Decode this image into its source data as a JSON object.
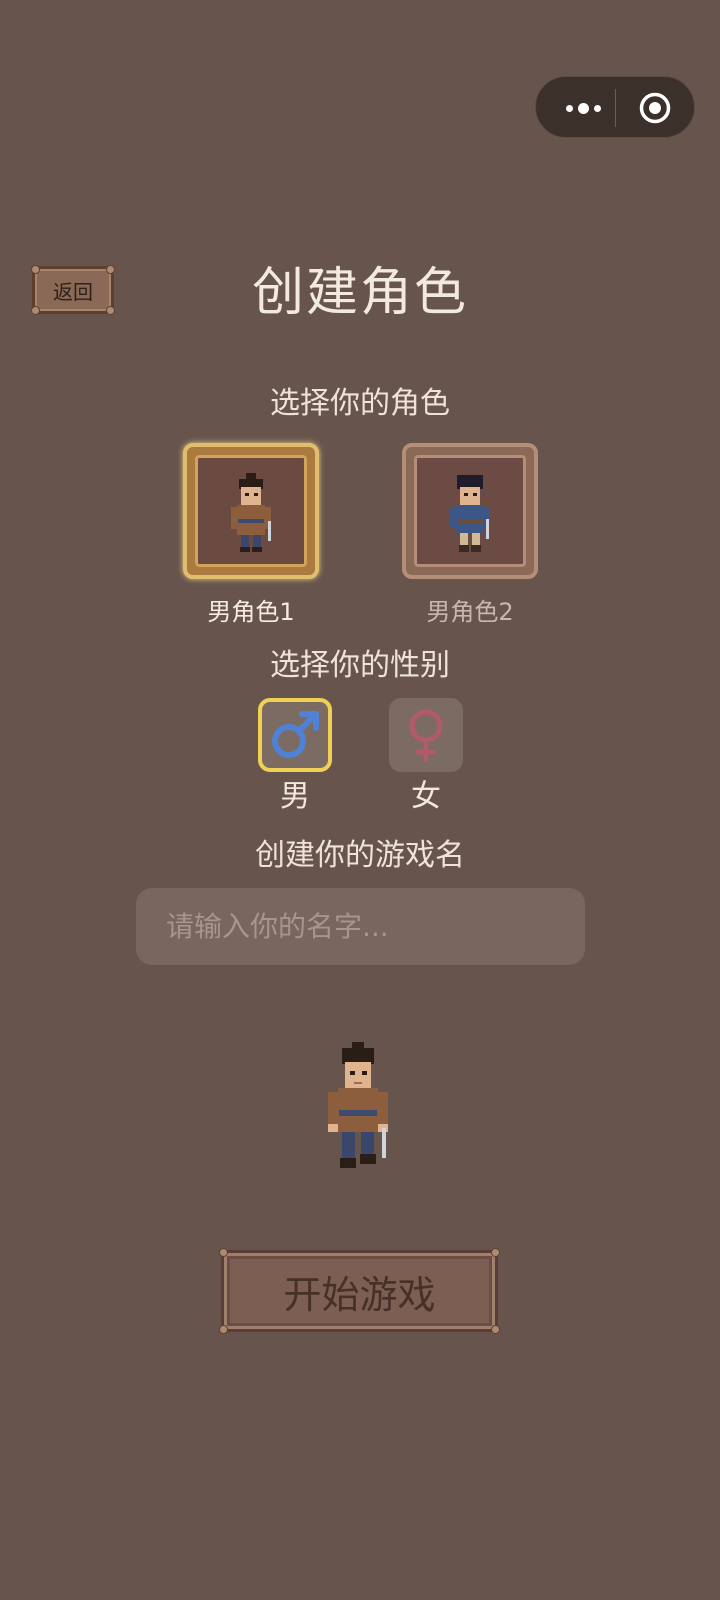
{
  "header": {
    "back_label": "返回",
    "title": "创建角色"
  },
  "capsule": {
    "more_icon": "more-dots-icon",
    "close_icon": "target-circle-icon"
  },
  "character": {
    "section_label": "选择你的角色",
    "options": [
      {
        "label": "男角色1",
        "selected": true
      },
      {
        "label": "男角色2",
        "selected": false
      }
    ]
  },
  "gender": {
    "section_label": "选择你的性别",
    "options": [
      {
        "label": "男",
        "icon": "male-symbol-icon",
        "color": "#4f82d6",
        "selected": true
      },
      {
        "label": "女",
        "icon": "female-symbol-icon",
        "color": "#b15a6a",
        "selected": false
      }
    ]
  },
  "name": {
    "section_label": "创建你的游戏名",
    "placeholder": "请输入你的名字...",
    "value": ""
  },
  "start_label": "开始游戏",
  "colors": {
    "background": "#67554d",
    "selected_highlight": "#f2cf55"
  }
}
